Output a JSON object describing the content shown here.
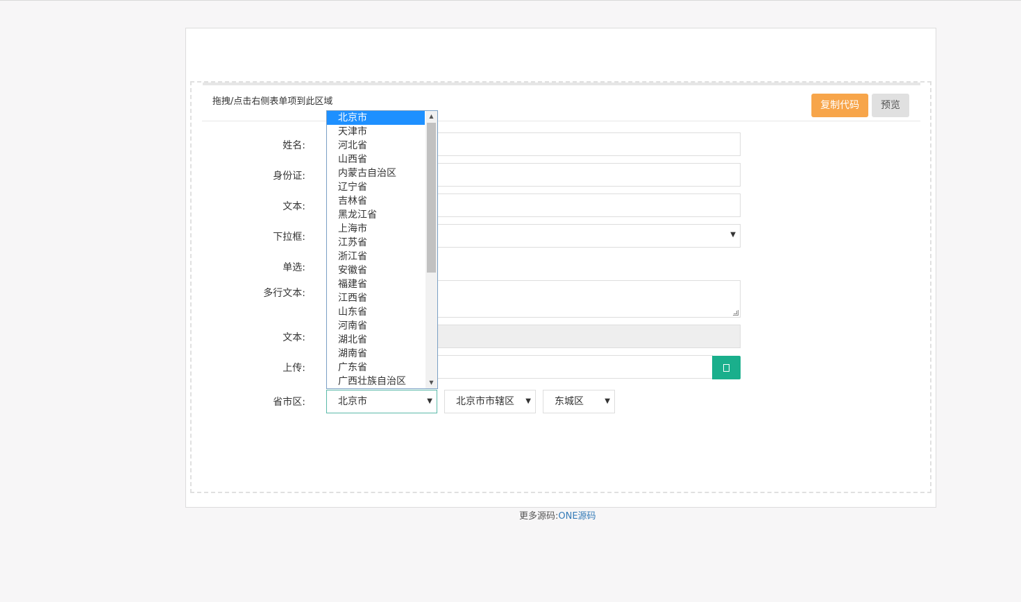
{
  "toolbar": {
    "hint": "拖拽/点击右侧表单项到此区域",
    "copy_label": "复制代码",
    "preview_label": "预览"
  },
  "form": {
    "name_label": "姓名:",
    "id_label": "身份证:",
    "text_label": "文本:",
    "select_label": "下拉框:",
    "radio_label": "单选:",
    "textarea_label": "多行文本:",
    "disabled_text_label": "文本:",
    "upload_label": "上传:",
    "region_label": "省市区:"
  },
  "region": {
    "province": "北京市",
    "city": "北京市市辖区",
    "district": "东城区"
  },
  "province_options": [
    "北京市",
    "天津市",
    "河北省",
    "山西省",
    "内蒙古自治区",
    "辽宁省",
    "吉林省",
    "黑龙江省",
    "上海市",
    "江苏省",
    "浙江省",
    "安徽省",
    "福建省",
    "江西省",
    "山东省",
    "河南省",
    "湖北省",
    "湖南省",
    "广东省",
    "广西壮族自治区"
  ],
  "icons": {
    "upload": "upload-icon",
    "caret": "chevron-down-icon"
  },
  "colors": {
    "copy_button": "#f7a54a",
    "preview_button": "#e0e0e0",
    "upload_button": "#1aaf8c",
    "selected_option": "#1e90ff",
    "link": "#337ab7"
  },
  "footer": {
    "prefix": "更多源码:",
    "link": "ONE源码"
  }
}
